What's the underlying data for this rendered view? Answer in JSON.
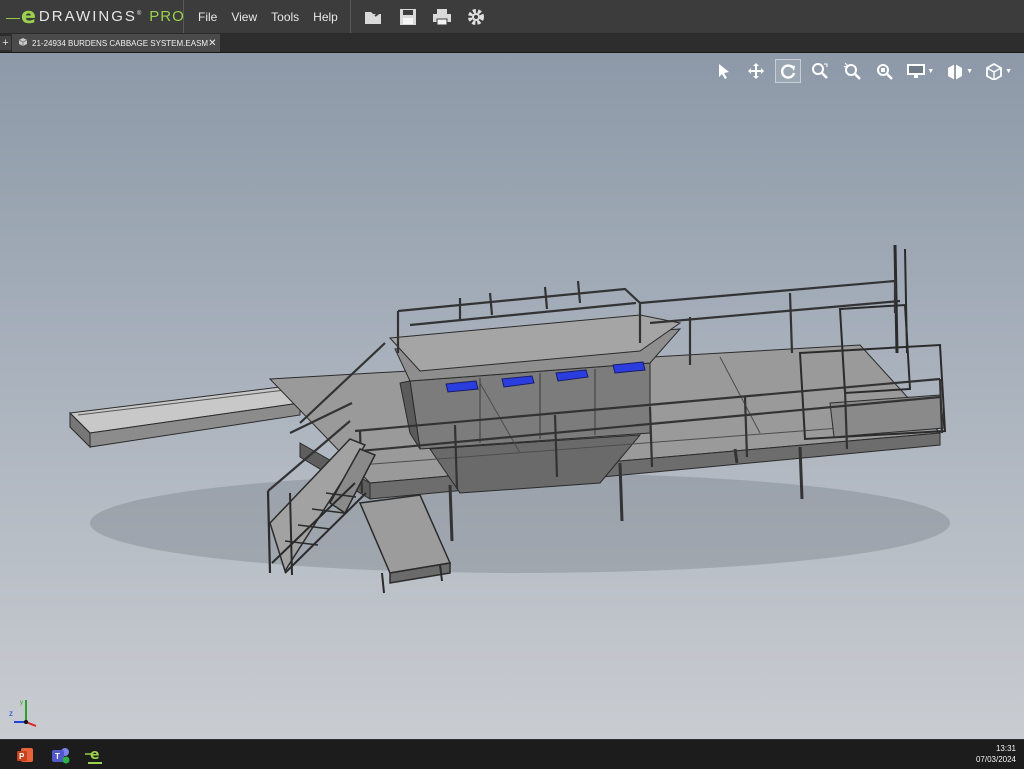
{
  "app": {
    "logo_mark": "e",
    "logo_brand": "DRAWINGS",
    "logo_tm": "®",
    "logo_edition": "PRO"
  },
  "menu": [
    "File",
    "View",
    "Tools",
    "Help"
  ],
  "toolbar_icons": [
    "open-file-icon",
    "save-icon",
    "print-icon",
    "settings-gear-icon"
  ],
  "tab": {
    "add_label": "+",
    "document_title": "21-24934 BURDENS CABBAGE SYSTEM.EASM",
    "close_label": "✕"
  },
  "view_tools": [
    "select-arrow-icon",
    "pan-icon",
    "rotate-icon",
    "zoom-to-area-icon",
    "zoom-in-out-icon",
    "zoom-to-fit-icon",
    "display-mode-icon",
    "section-view-icon",
    "standard-views-cube-icon"
  ],
  "view_tools_active": "rotate-icon",
  "colors": {
    "accent_green": "#9bd14c",
    "model_steel": "#5a5a5a",
    "highlight_blue": "#2a3ee0"
  },
  "taskbar": {
    "apps": [
      "powerpoint-icon",
      "teams-icon",
      "edrawings-icon"
    ],
    "time": "13:31",
    "date": "07/03/2024"
  }
}
